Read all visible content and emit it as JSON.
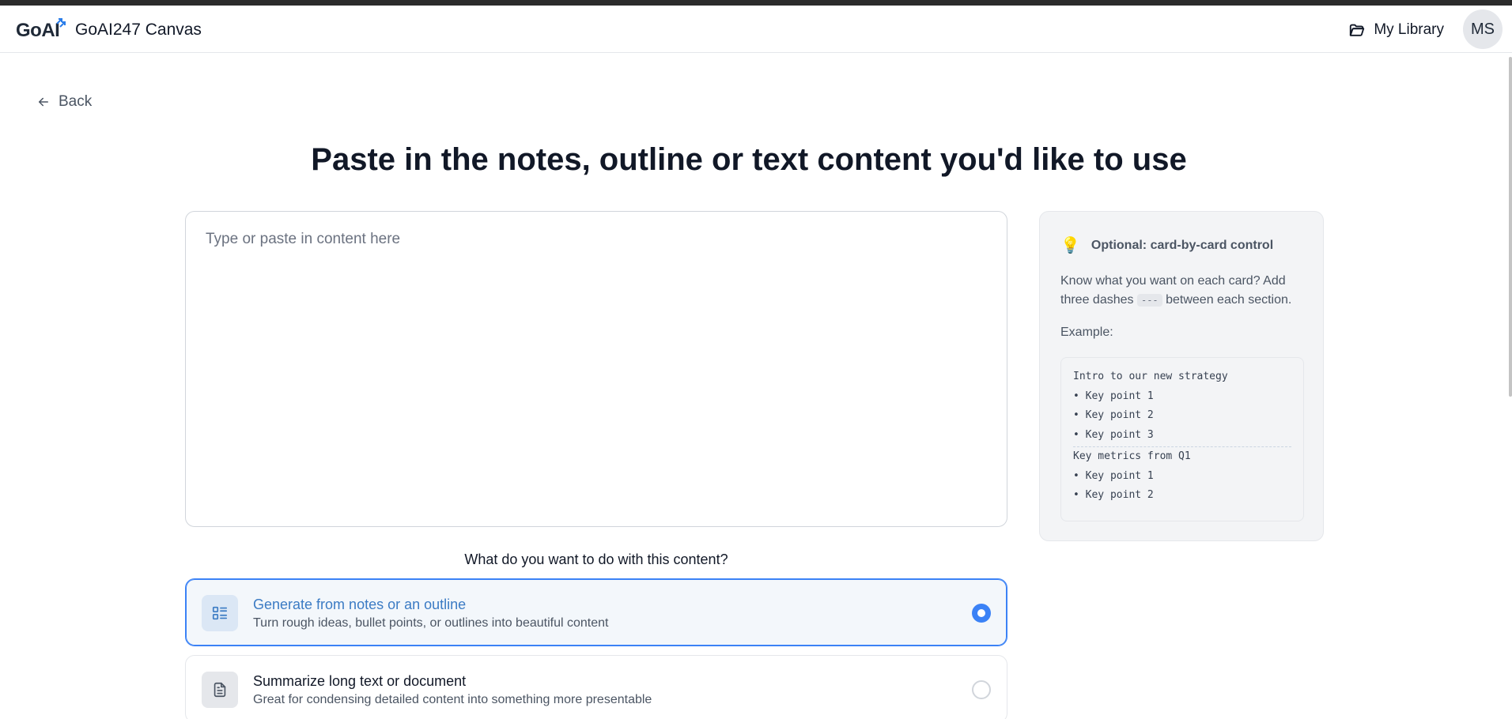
{
  "header": {
    "logo_text": "GoAI",
    "app_title": "GoAI247 Canvas",
    "library_label": "My Library",
    "avatar_initials": "MS"
  },
  "nav": {
    "back_label": "Back"
  },
  "main": {
    "title": "Paste in the notes, outline or text content you'd like to use",
    "content_placeholder": "Type or paste in content here",
    "content_value": "",
    "question": "What do you want to do with this content?",
    "options": [
      {
        "title": "Generate from notes or an outline",
        "description": "Turn rough ideas, bullet points, or outlines into beautiful content",
        "icon": "list-layout-icon",
        "selected": true
      },
      {
        "title": "Summarize long text or document",
        "description": "Great for condensing detailed content into something more presentable",
        "icon": "document-icon",
        "selected": false
      }
    ]
  },
  "tip": {
    "icon": "lightbulb-icon",
    "title": "Optional: card-by-card control",
    "desc_before": "Know what you want on each card? Add three dashes",
    "desc_code": "---",
    "desc_after": "between each section.",
    "example_label": "Example:",
    "example_block1": [
      "Intro to our new strategy",
      "• Key point 1",
      "• Key point 2",
      "• Key point 3"
    ],
    "example_block2": [
      "Key metrics from Q1",
      "• Key point 1",
      "• Key point 2"
    ]
  },
  "colors": {
    "accent": "#3b82f6",
    "selected_text": "#3b7bc4",
    "top_strip": "#2b2b2b"
  }
}
